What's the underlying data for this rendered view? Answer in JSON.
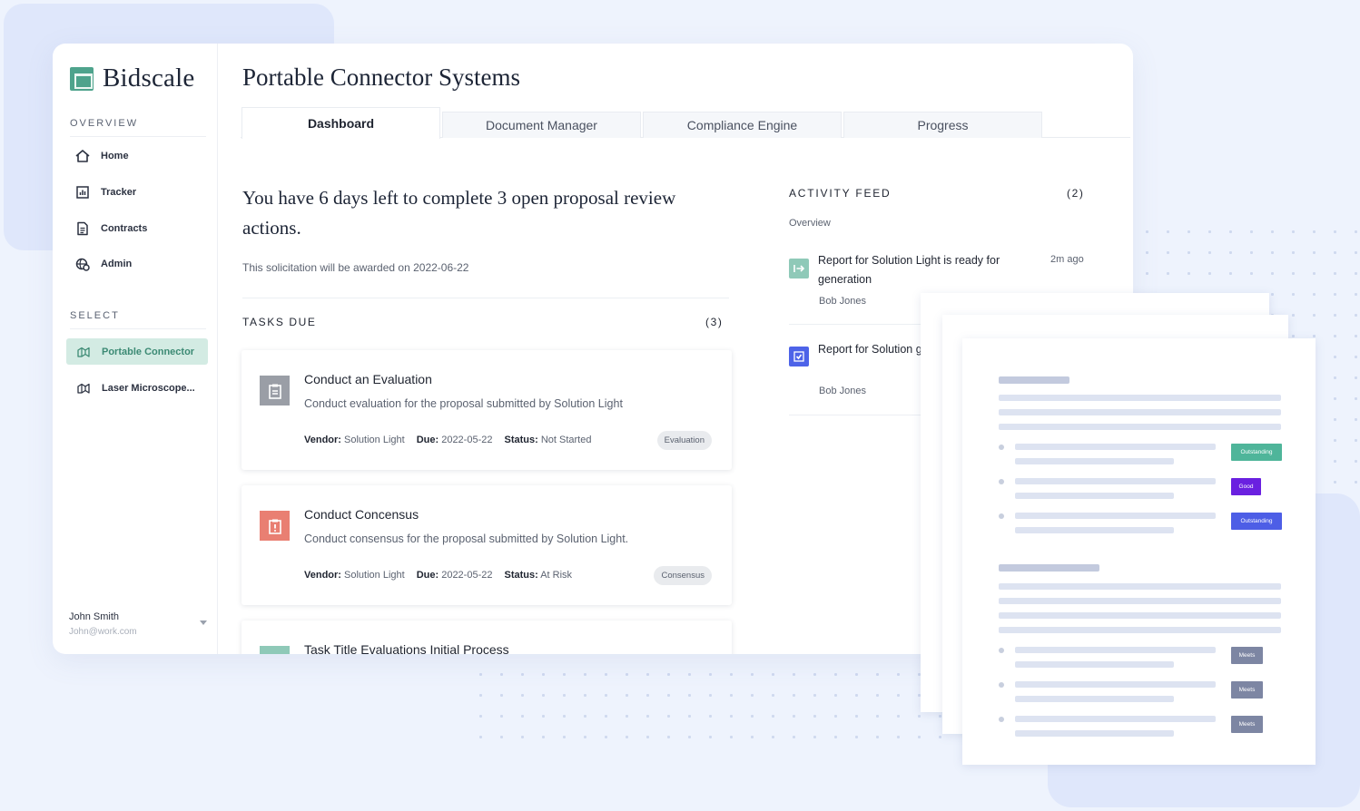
{
  "app": {
    "name": "Bidscale"
  },
  "sidebar": {
    "overview_label": "OVERVIEW",
    "nav_items": [
      {
        "label": "Home",
        "icon": "home-icon"
      },
      {
        "label": "Tracker",
        "icon": "chart-icon"
      },
      {
        "label": "Contracts",
        "icon": "document-icon"
      },
      {
        "label": "Admin",
        "icon": "globe-gear-icon"
      }
    ],
    "select_label": "SELECT",
    "select_items": [
      {
        "label": "Portable Connector",
        "icon": "microscope-icon",
        "active": true
      },
      {
        "label": "Laser Microscope...",
        "icon": "microscope-icon",
        "active": false
      }
    ],
    "user": {
      "name": "John Smith",
      "email": "John@work.com"
    }
  },
  "page": {
    "title": "Portable Connector Systems",
    "tabs": [
      {
        "label": "Dashboard",
        "active": true
      },
      {
        "label": "Document Manager",
        "active": false
      },
      {
        "label": "Compliance Engine",
        "active": false
      },
      {
        "label": "Progress",
        "active": false
      }
    ]
  },
  "dashboard": {
    "headline": "You have 6 days left to complete 3 open proposal review actions.",
    "subtext": "This solicitation will be awarded on 2022-06-22",
    "tasks_label": "TASKS DUE",
    "tasks_count": "(3)",
    "tasks": [
      {
        "title": "Conduct an Evaluation",
        "description": "Conduct evaluation for the proposal submitted by Solution Light",
        "vendor_label": "Vendor:",
        "vendor": "Solution Light",
        "due_label": "Due:",
        "due": "2022-05-22",
        "status_label": "Status:",
        "status": "Not Started",
        "tag": "Evaluation",
        "icon": "clipboard-icon",
        "icon_color": "#9a9ea6"
      },
      {
        "title": "Conduct Concensus",
        "description": "Conduct consensus for the proposal submitted by Solution Light.",
        "vendor_label": "Vendor:",
        "vendor": "Solution Light",
        "due_label": "Due:",
        "due": "2022-05-22",
        "status_label": "Status:",
        "status": "At Risk",
        "tag": "Consensus",
        "icon": "clipboard-alert-icon",
        "icon_color": "#e97f72"
      },
      {
        "title": "Task Title Evaluations Initial Process",
        "icon_color": "#8fc9b8"
      }
    ]
  },
  "activity_feed": {
    "label": "ACTIVITY FEED",
    "count": "(2)",
    "subtitle": "Overview",
    "items": [
      {
        "text": "Report for Solution Light is ready for generation",
        "author": "Bob Jones",
        "time": "2m ago",
        "icon": "export-icon",
        "icon_color": "#8fc9b8"
      },
      {
        "text": "Report for Solution generated",
        "author": "Bob Jones",
        "icon": "check-icon",
        "icon_color": "#4d63e8"
      }
    ]
  },
  "document_preview": {
    "badges": [
      "Outstanding",
      "Good",
      "Outstanding",
      "Meets",
      "Meets",
      "Meets"
    ],
    "badge_colors": [
      "#4fb59a",
      "#6a20e0",
      "#4d5ee6",
      "#7d86a3",
      "#7d86a3",
      "#7d86a3"
    ]
  }
}
